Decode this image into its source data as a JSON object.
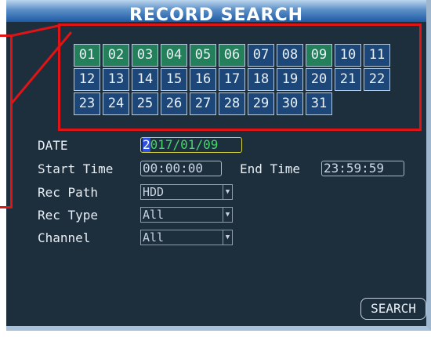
{
  "title": "RECORD SEARCH",
  "calendar": {
    "days": [
      {
        "label": "01",
        "has_record": true
      },
      {
        "label": "02",
        "has_record": true
      },
      {
        "label": "03",
        "has_record": true
      },
      {
        "label": "04",
        "has_record": true
      },
      {
        "label": "05",
        "has_record": true
      },
      {
        "label": "06",
        "has_record": true
      },
      {
        "label": "07",
        "has_record": false
      },
      {
        "label": "08",
        "has_record": false
      },
      {
        "label": "09",
        "has_record": true
      },
      {
        "label": "10",
        "has_record": false
      },
      {
        "label": "11",
        "has_record": false
      },
      {
        "label": "12",
        "has_record": false
      },
      {
        "label": "13",
        "has_record": false
      },
      {
        "label": "14",
        "has_record": false
      },
      {
        "label": "15",
        "has_record": false
      },
      {
        "label": "16",
        "has_record": false
      },
      {
        "label": "17",
        "has_record": false
      },
      {
        "label": "18",
        "has_record": false
      },
      {
        "label": "19",
        "has_record": false
      },
      {
        "label": "20",
        "has_record": false
      },
      {
        "label": "21",
        "has_record": false
      },
      {
        "label": "22",
        "has_record": false
      },
      {
        "label": "23",
        "has_record": false
      },
      {
        "label": "24",
        "has_record": false
      },
      {
        "label": "25",
        "has_record": false
      },
      {
        "label": "26",
        "has_record": false
      },
      {
        "label": "27",
        "has_record": false
      },
      {
        "label": "28",
        "has_record": false
      },
      {
        "label": "29",
        "has_record": false
      },
      {
        "label": "30",
        "has_record": false
      },
      {
        "label": "31",
        "has_record": false
      }
    ]
  },
  "form": {
    "date_label": "DATE",
    "date_cursor": "2",
    "date_rest": "017/01/09",
    "start_time_label": "Start Time",
    "start_time_value": "00:00:00",
    "end_time_label": "End Time",
    "end_time_value": "23:59:59",
    "rec_path_label": "Rec Path",
    "rec_path_value": "HDD",
    "rec_type_label": "Rec Type",
    "rec_type_value": "All",
    "channel_label": "Channel",
    "channel_value": "All"
  },
  "search_label": "SEARCH",
  "colors": {
    "recorded_day": "#24805a",
    "normal_day": "#1c4778",
    "highlight": "#e01414"
  }
}
